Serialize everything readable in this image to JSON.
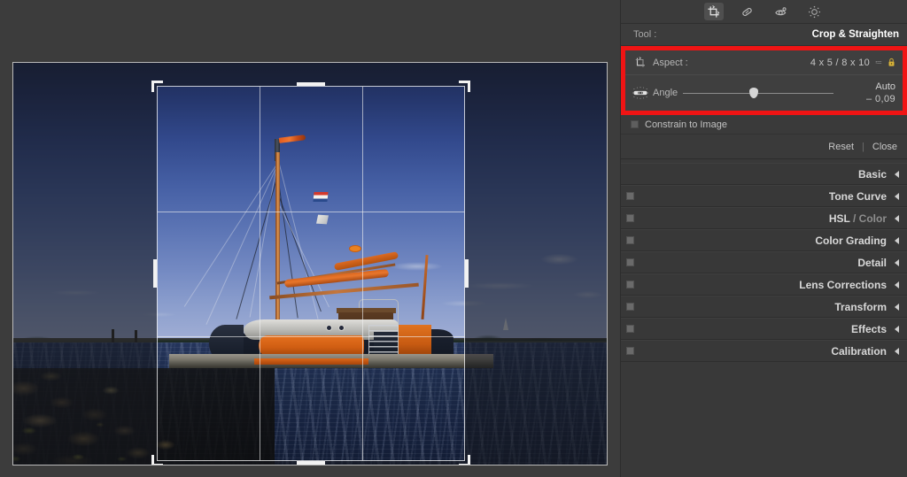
{
  "toolbar": {
    "tools": [
      {
        "name": "crop-tool",
        "icon": "crop-icon",
        "active": true
      },
      {
        "name": "healing-tool",
        "icon": "bandage-icon",
        "active": false
      },
      {
        "name": "redeye-tool",
        "icon": "eye-icon",
        "active": false
      },
      {
        "name": "masking-tool",
        "icon": "radial-dots-icon",
        "active": false
      }
    ]
  },
  "tool_header": {
    "label": "Tool :",
    "value": "Crop & Straighten"
  },
  "crop_panel": {
    "highlight_color": "#f01414",
    "aspect": {
      "icon": "crop-aspect-icon",
      "label": "Aspect :",
      "value": "4 x 5  /  8 x 10",
      "caret": "≔",
      "lock_icon": "lock-closed-icon",
      "lock_color": "#d9b43a"
    },
    "angle": {
      "icon": "spirit-level-icon",
      "label": "Angle",
      "auto_label": "Auto",
      "value": "– 0,09",
      "slider_position_percent": 47
    },
    "constrain": {
      "label": "Constrain to Image",
      "checked": false
    },
    "buttons": {
      "reset": "Reset",
      "separator": "|",
      "close": "Close"
    }
  },
  "panels": [
    {
      "title": "Basic",
      "title_muted": "",
      "has_toggle": false
    },
    {
      "title": "Tone Curve",
      "title_muted": "",
      "has_toggle": true
    },
    {
      "title": "HSL",
      "title_muted": " / Color",
      "has_toggle": true
    },
    {
      "title": "Color Grading",
      "title_muted": "",
      "has_toggle": true
    },
    {
      "title": "Detail",
      "title_muted": "",
      "has_toggle": true
    },
    {
      "title": "Lens Corrections",
      "title_muted": "",
      "has_toggle": true
    },
    {
      "title": "Transform",
      "title_muted": "",
      "has_toggle": true
    },
    {
      "title": "Effects",
      "title_muted": "",
      "has_toggle": true
    },
    {
      "title": "Calibration",
      "title_muted": "",
      "has_toggle": true
    }
  ],
  "canvas": {
    "photo_description": "Moored traditional wooden sailing boat with orange hull trim at a jetty, rocky shoreline in foreground, blue sky",
    "crop_overlay": {
      "grid": "rule-of-thirds",
      "corner_handles": 4,
      "edge_handles": 4
    }
  }
}
